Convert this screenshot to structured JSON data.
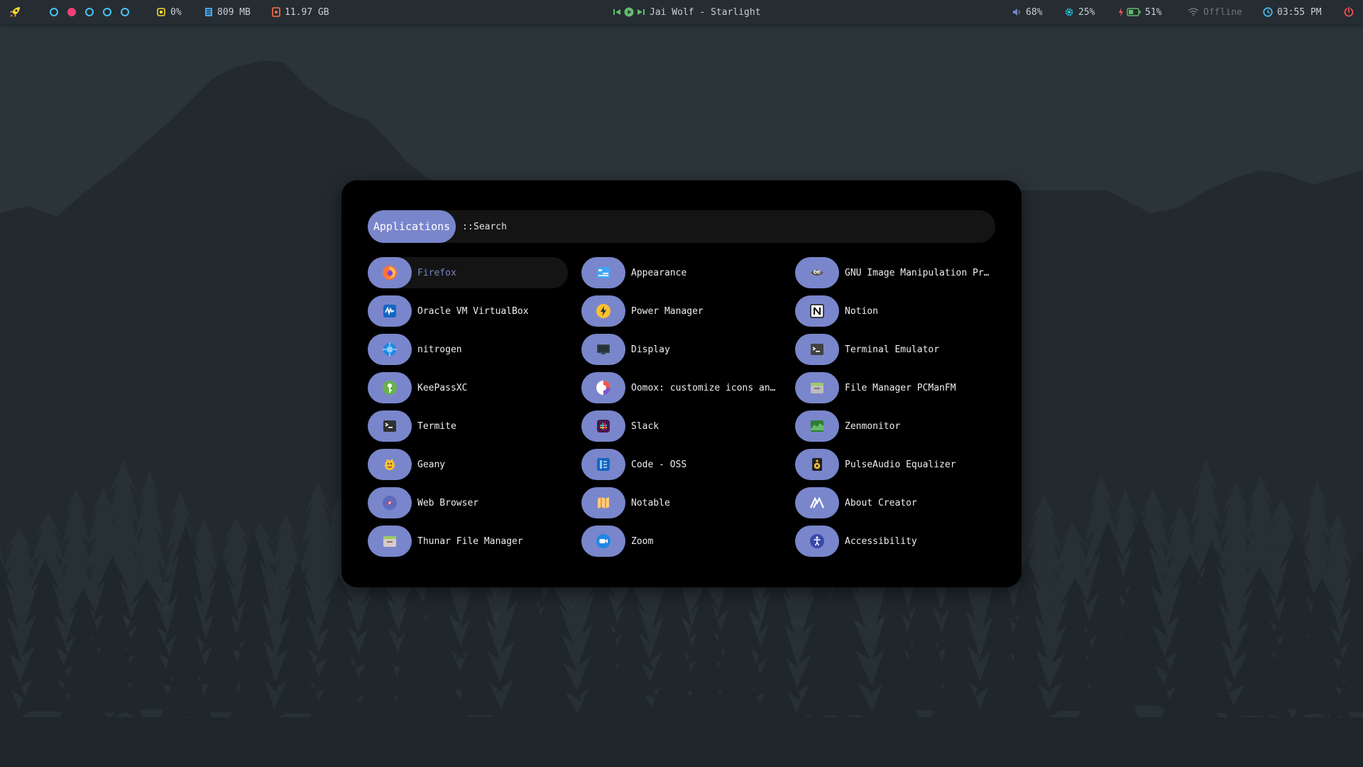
{
  "colors": {
    "accent": "#7986cb",
    "bar_bg": "#252d32",
    "launcher_bg": "#000000",
    "workspace_idle": "#4fc3f7",
    "workspace_active": "#ec407a",
    "cpu": "#fdd835",
    "memory": "#42a5f5",
    "disk": "#ff7043",
    "music": "#66bb6a",
    "volume": "#7986cb",
    "brightness": "#26c6da",
    "battery": "#66bb6a",
    "charging": "#ef5350",
    "network_offline": "#6d767b",
    "clock": "#4fc3f7",
    "power": "#ef5350"
  },
  "topbar": {
    "launcher_icon": "rocket-icon",
    "workspaces": [
      {
        "active": false
      },
      {
        "active": true
      },
      {
        "active": false
      },
      {
        "active": false
      },
      {
        "active": false
      }
    ],
    "cpu": {
      "icon": "cpu-icon",
      "value": "0%"
    },
    "memory": {
      "icon": "memory-icon",
      "value": "809 MB"
    },
    "disk": {
      "icon": "disk-icon",
      "value": "11.97 GB"
    },
    "music": {
      "prev_icon": "skip-previous-icon",
      "play_icon": "play-icon",
      "next_icon": "skip-next-icon",
      "track": "Jai Wolf - Starlight"
    },
    "volume": {
      "icon": "volume-icon",
      "value": "68%"
    },
    "brightness": {
      "icon": "brightness-icon",
      "value": "25%"
    },
    "battery": {
      "icon": "battery-charging-icon",
      "value": "51%",
      "level": 0.51
    },
    "network": {
      "icon": "wifi-icon",
      "value": "Offline"
    },
    "clock": {
      "icon": "clock-icon",
      "value": "03:55 PM"
    },
    "power_icon": "power-icon"
  },
  "launcher": {
    "mode": "Applications",
    "prompt": "::",
    "search_placeholder": "Search",
    "apps": [
      {
        "label": "Firefox",
        "icon": "firefox-icon",
        "selected": true
      },
      {
        "label": "Appearance",
        "icon": "appearance-icon"
      },
      {
        "label": "GNU Image Manipulation Progr…",
        "icon": "gimp-icon"
      },
      {
        "label": "Oracle VM VirtualBox",
        "icon": "virtualbox-icon"
      },
      {
        "label": "Power Manager",
        "icon": "power-manager-icon"
      },
      {
        "label": "Notion",
        "icon": "notion-icon"
      },
      {
        "label": "nitrogen",
        "icon": "nitrogen-icon"
      },
      {
        "label": "Display",
        "icon": "display-icon"
      },
      {
        "label": "Terminal Emulator",
        "icon": "terminal-emulator-icon"
      },
      {
        "label": "KeePassXC",
        "icon": "keepassxc-icon"
      },
      {
        "label": "Oomox: customize icons and G…",
        "icon": "oomox-icon"
      },
      {
        "label": "File Manager PCManFM",
        "icon": "pcmanfm-icon"
      },
      {
        "label": "Termite",
        "icon": "termite-icon"
      },
      {
        "label": "Slack",
        "icon": "slack-icon"
      },
      {
        "label": "Zenmonitor",
        "icon": "zenmonitor-icon"
      },
      {
        "label": "Geany",
        "icon": "geany-icon"
      },
      {
        "label": "Code - OSS",
        "icon": "code-oss-icon"
      },
      {
        "label": "PulseAudio Equalizer",
        "icon": "pulseaudio-equalizer-icon"
      },
      {
        "label": "Web Browser",
        "icon": "web-browser-icon"
      },
      {
        "label": "Notable",
        "icon": "notable-icon"
      },
      {
        "label": "About Creator",
        "icon": "about-creator-icon"
      },
      {
        "label": "Thunar File Manager",
        "icon": "thunar-icon"
      },
      {
        "label": "Zoom",
        "icon": "zoom-icon"
      },
      {
        "label": "Accessibility",
        "icon": "accessibility-icon"
      }
    ]
  }
}
